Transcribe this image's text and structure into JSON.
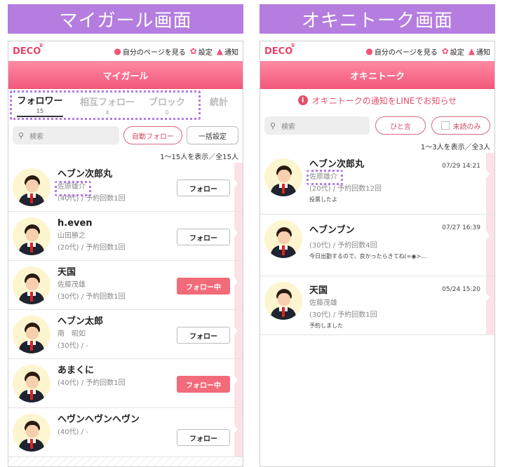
{
  "titles": {
    "left": "マイガール画面",
    "right": "オキニトーク画面"
  },
  "topbar": {
    "logo": "DECO",
    "mypage": "自分のページを見る",
    "settings": "設定",
    "notify": "通知"
  },
  "left": {
    "header": "マイガール",
    "tabs": [
      {
        "label": "フォロワー",
        "count": "15"
      },
      {
        "label": "相互フォロー",
        "count": "4"
      },
      {
        "label": "ブロック",
        "count": "0"
      },
      {
        "label": "統計",
        "count": ""
      }
    ],
    "search_placeholder": "検索",
    "auto_follow": "自動フォロー",
    "bulk_setting": "一括設定",
    "count_text": "1〜15人を表示／全15人",
    "rows": [
      {
        "name": "ヘブン次郎丸",
        "real": "佐原雄介",
        "age": "(40代) /  予約回数1回",
        "button": "フォロー"
      },
      {
        "name": "h.even",
        "real": "山田勝之",
        "age": "(20代) /  予約回数1回",
        "button": "フォロー"
      },
      {
        "name": "天国",
        "real": "佐藤茂雄",
        "age": "(30代) /  予約回数1回",
        "button": "フォロー中"
      },
      {
        "name": "ヘブン太郎",
        "real": "南　昭如",
        "age": "(30代) /  -",
        "button": "フォロー"
      },
      {
        "name": "あまくに",
        "real": "",
        "age": "(40代) /  予約回数1回",
        "button": "フォロー中"
      },
      {
        "name": "ヘヴンヘヴンヘヴン",
        "real": "",
        "age": "(40代) /  -",
        "button": "フォロー"
      }
    ]
  },
  "right": {
    "header": "オキニトーク",
    "notice": "オキニトークの通知をLINEでお知らせ",
    "search_placeholder": "検索",
    "hitokoto": "ひと言",
    "unread": "未読のみ",
    "count_text": "1〜3人を表示／全3人",
    "rows": [
      {
        "name": "ヘブン次郎丸",
        "real": "佐原雄介",
        "age": "(20代) /  予約回数12回",
        "msg": "投票したよ",
        "date": "07/29 14:21"
      },
      {
        "name": "ヘブンブン",
        "real": "",
        "age": "(30代) /  予約回数4回",
        "msg": "今日出勤するので、良かったらきてね(∞◉>…",
        "date": "07/27 16:39"
      },
      {
        "name": "天国",
        "real": "佐藤茂雄",
        "age": "(30代) /  予約回数1回",
        "msg": "予約しました",
        "date": "05/24 15:20"
      }
    ]
  },
  "colors": {
    "title_bg": "#b57ddf",
    "accent_pink": "#f2577a",
    "dotted_highlight": "#b07be0"
  }
}
